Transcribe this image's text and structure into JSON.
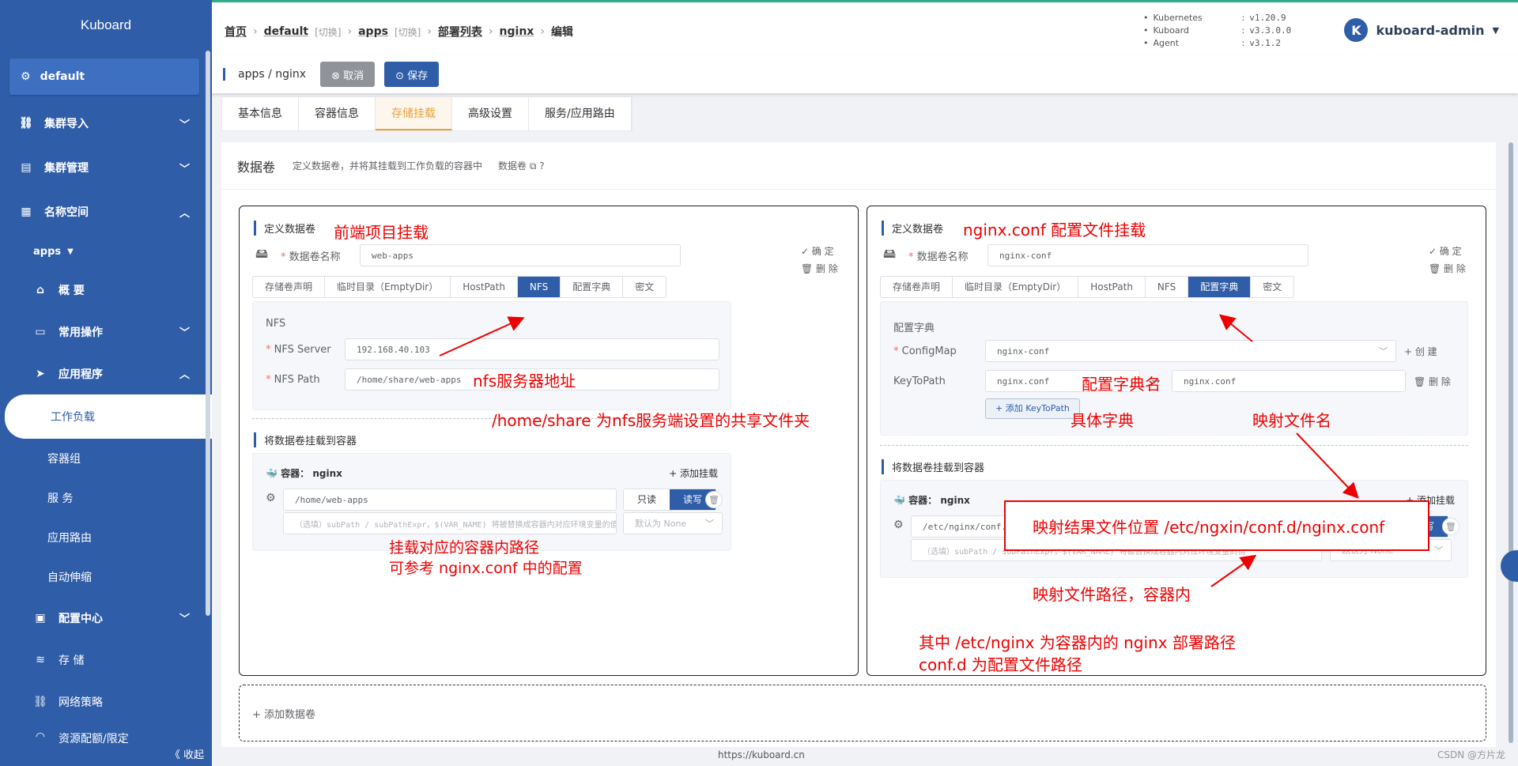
{
  "sidebar": {
    "brand": "Kuboard",
    "cluster": "default",
    "items": [
      {
        "label": "集群导入"
      },
      {
        "label": "集群管理"
      },
      {
        "label": "名称空间"
      },
      {
        "label": "apps"
      },
      {
        "label": "概 要"
      },
      {
        "label": "常用操作"
      },
      {
        "label": "应用程序"
      },
      {
        "label": "工作负载"
      },
      {
        "label": "容器组"
      },
      {
        "label": "服 务"
      },
      {
        "label": "应用路由"
      },
      {
        "label": "自动伸缩"
      },
      {
        "label": "配置中心"
      },
      {
        "label": "存 储"
      },
      {
        "label": "网络策略"
      },
      {
        "label": "资源配额/限定"
      }
    ],
    "collapse": "《 收起"
  },
  "breadcrumb": {
    "home": "首页",
    "cluster": "default",
    "switch1": "[切换]",
    "ns": "apps",
    "switch2": "[切换]",
    "deploy_list": "部署列表",
    "name": "nginx",
    "current": "编辑"
  },
  "versions": [
    {
      "k": "Kubernetes",
      "v": "v1.20.9"
    },
    {
      "k": "Kuboard",
      "v": "v3.3.0.0"
    },
    {
      "k": "Agent",
      "v": "v3.1.2"
    }
  ],
  "user": {
    "avatar": "K",
    "name": "kuboard-admin"
  },
  "actionbar": {
    "path": "apps / nginx",
    "cancel": "⊗ 取消",
    "save": "⊙ 保存"
  },
  "tabs": [
    "基本信息",
    "容器信息",
    "存储挂载",
    "高级设置",
    "服务/应用路由"
  ],
  "section": {
    "title": "数据卷",
    "desc": "定义数据卷，并将其挂载到工作负载的容器中",
    "link": "数据卷"
  },
  "left": {
    "title": "定义数据卷",
    "vol_label": "数据卷名称",
    "vol_name": "web-apps",
    "confirm": "✓ 确 定",
    "delete": "🗑 删 除",
    "types": [
      "存储卷声明",
      "临时目录（EmptyDir）",
      "HostPath",
      "NFS",
      "配置字典",
      "密文"
    ],
    "nfs_title": "NFS",
    "server_label": "NFS Server",
    "server": "192.168.40.103",
    "path_label": "NFS Path",
    "path": "/home/share/web-apps",
    "mount_title": "将数据卷挂载到容器",
    "container": "容器：  nginx",
    "add_mount": "+ 添加挂载",
    "mount_path": "/home/web-apps",
    "readonly": "只读",
    "readwrite": "读写",
    "subpath_ph": "（选填）subPath / subPathExpr，$(VAR_NAME) 将被替换成容器内对应环境变量的值",
    "default_ph": "默认为 None"
  },
  "right": {
    "title": "定义数据卷",
    "vol_label": "数据卷名称",
    "vol_name": "nginx-conf",
    "confirm": "✓ 确 定",
    "delete": "🗑 删 除",
    "types": [
      "存储卷声明",
      "临时目录（EmptyDir）",
      "HostPath",
      "NFS",
      "配置字典",
      "密文"
    ],
    "cm_title": "配置字典",
    "cm_label": "ConfigMap",
    "cm_value": "nginx-conf",
    "create": "+ 创 建",
    "ktp_label": "KeyToPath",
    "key": "nginx.conf",
    "path": "nginx.conf",
    "ktp_delete": "🗑 删 除",
    "add_ktp": "+ 添加 KeyToPath",
    "mount_title": "将数据卷挂载到容器",
    "container": "容器：  nginx",
    "add_mount": "+ 添加挂载",
    "mount_path": "/etc/nginx/conf.d/",
    "readonly": "只读",
    "readwrite": "读写",
    "subpath_ph": "（选填）subPath / subPathExpr，$(VAR_NAME) 将被替换成容器内对应环境变量的值",
    "default_ph": "默认为 None"
  },
  "add_volume": "+ 添加数据卷",
  "notes": {
    "n1": "前端项目挂载",
    "n2": "nfs服务器地址",
    "n3": "/home/share   为nfs服务端设置的共享文件夹",
    "n4a": "挂载对应的容器内路径",
    "n4b": "可参考 nginx.conf 中的配置",
    "n5": "nginx.conf  配置文件挂载",
    "n6": "配置字典名",
    "n7": "具体字典",
    "n8": "映射文件名",
    "n9": "映射结果文件位置    /etc/ngxin/conf.d/nginx.conf",
    "n10": "映射文件路径，容器内",
    "n11a": "其中  /etc/nginx   为容器内的 nginx 部署路径",
    "n11b": "conf.d  为配置文件路径"
  },
  "footer": "https://kuboard.cn",
  "watermark": "CSDN @方片龙"
}
